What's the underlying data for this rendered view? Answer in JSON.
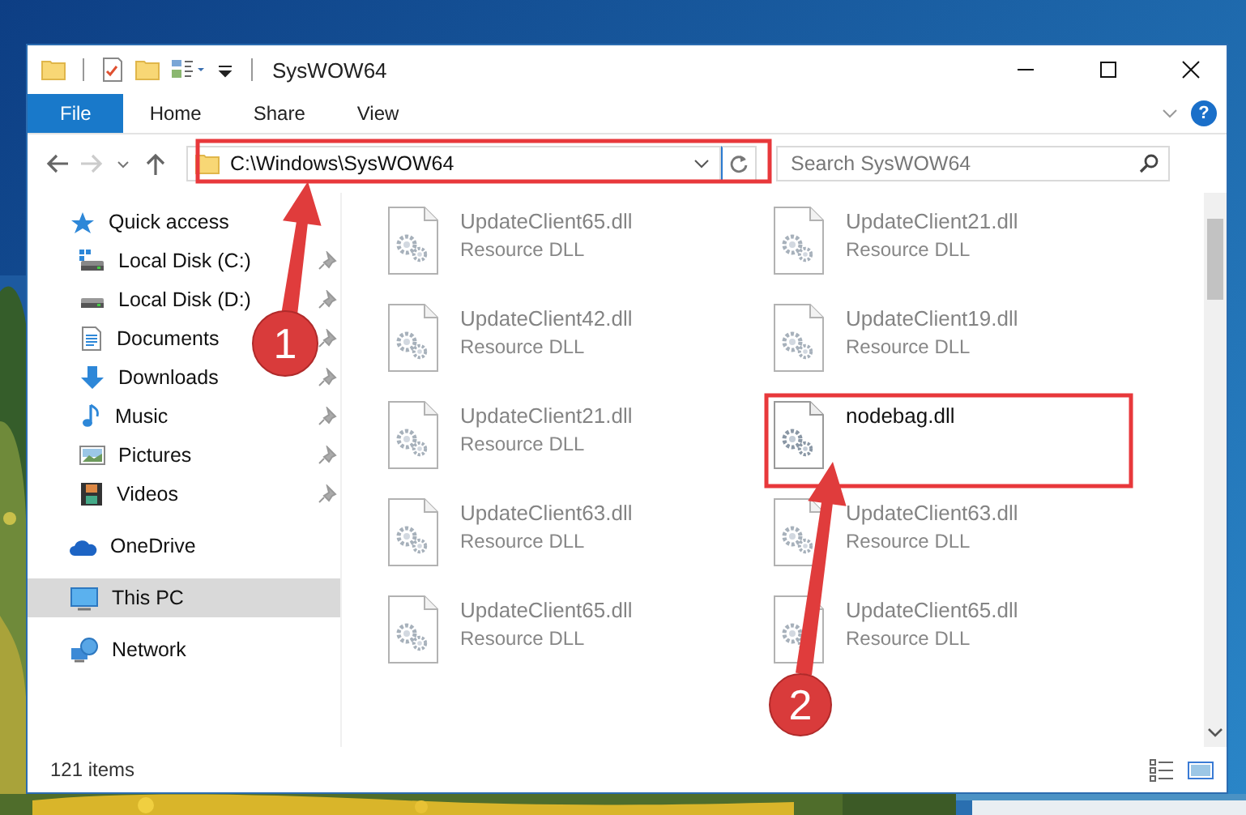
{
  "window": {
    "title": "SysWOW64"
  },
  "ribbon": {
    "tabs": [
      {
        "label": "File",
        "selected": true
      },
      {
        "label": "Home",
        "selected": false
      },
      {
        "label": "Share",
        "selected": false
      },
      {
        "label": "View",
        "selected": false
      }
    ],
    "help": "?"
  },
  "address_bar": {
    "path": "C:\\Windows\\SysWOW64"
  },
  "search": {
    "placeholder": "Search SysWOW64"
  },
  "sidebar": {
    "items": [
      {
        "label": "Quick access",
        "kind": "star",
        "selected": false,
        "children": [
          {
            "label": "Local Disk (C:)",
            "kind": "system-drive",
            "pinned": true,
            "selected": false
          },
          {
            "label": "Local Disk (D:)",
            "kind": "drive",
            "pinned": true,
            "selected": false
          },
          {
            "label": "Documents",
            "kind": "documents",
            "pinned": true,
            "selected": false
          },
          {
            "label": "Downloads",
            "kind": "downloads",
            "pinned": true,
            "selected": false
          },
          {
            "label": "Music",
            "kind": "music",
            "pinned": true,
            "selected": false
          },
          {
            "label": "Pictures",
            "kind": "pictures",
            "pinned": true,
            "selected": false
          },
          {
            "label": "Videos",
            "kind": "videos",
            "pinned": true,
            "selected": false
          }
        ]
      },
      {
        "label": "OneDrive",
        "kind": "cloud",
        "selected": false
      },
      {
        "label": "This PC",
        "kind": "pc",
        "selected": true
      },
      {
        "label": "Network",
        "kind": "network",
        "selected": false
      }
    ]
  },
  "files": [
    {
      "name": "UpdateClient65.dll",
      "type": "Resource DLL",
      "blurred": true
    },
    {
      "name": "UpdateClient21.dll",
      "type": "Resource DLL",
      "blurred": true
    },
    {
      "name": "UpdateClient42.dll",
      "type": "Resource DLL",
      "blurred": true
    },
    {
      "name": "UpdateClient19.dll",
      "type": "Resource DLL",
      "blurred": true
    },
    {
      "name": "UpdateClient21.dll",
      "type": "Resource DLL",
      "blurred": true
    },
    {
      "name": "nodebag.dll",
      "blurred": false
    },
    {
      "name": "UpdateClient63.dll",
      "type": "Resource DLL",
      "blurred": true
    },
    {
      "name": "UpdateClient63.dll",
      "type": "Resource DLL",
      "blurred": true
    },
    {
      "name": "UpdateClient65.dll",
      "type": "Resource DLL",
      "blurred": true
    },
    {
      "name": "UpdateClient65.dll",
      "type": "Resource DLL",
      "blurred": true
    }
  ],
  "status_bar": {
    "item_count": "121 items"
  },
  "annotations": [
    {
      "number": "1"
    },
    {
      "number": "2"
    }
  ]
}
